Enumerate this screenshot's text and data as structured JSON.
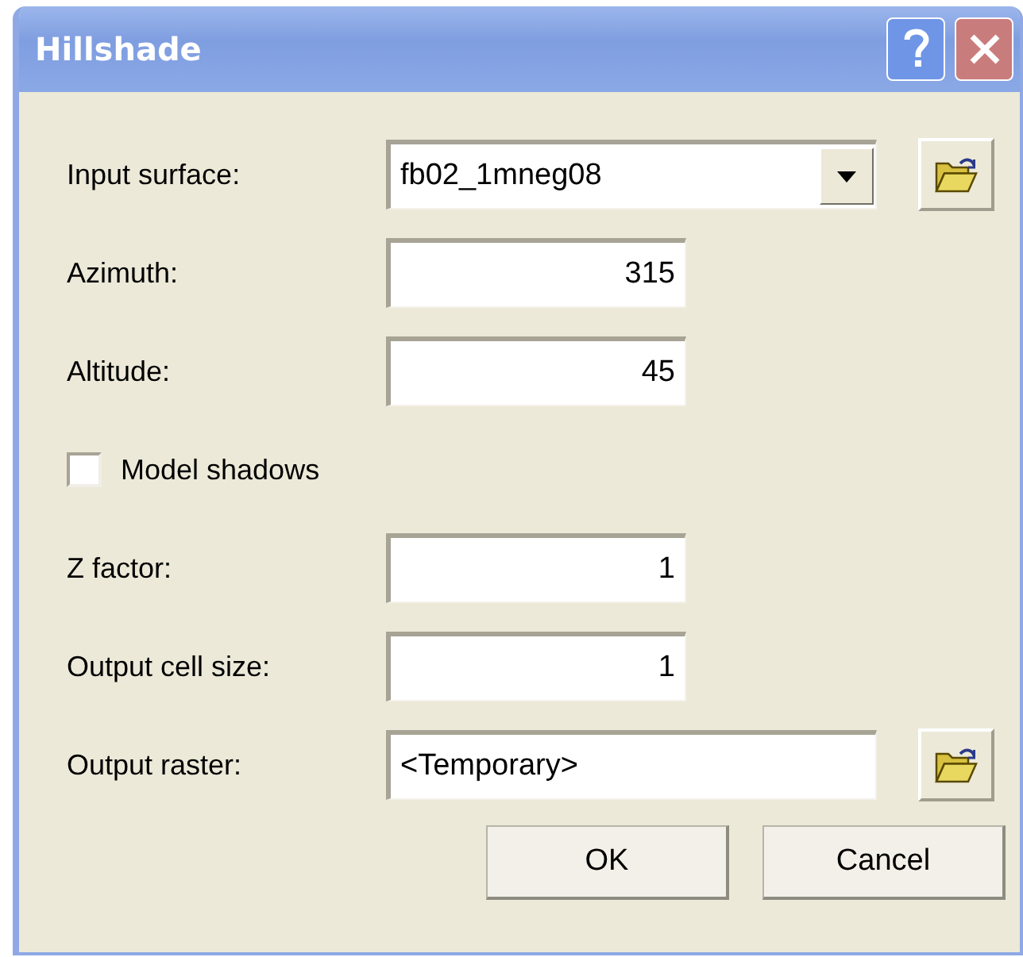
{
  "window": {
    "title": "Hillshade"
  },
  "fields": [
    {
      "kind": "combo",
      "label": "Input surface:",
      "value": "fb02_1mneg08",
      "browse": true
    },
    {
      "kind": "number",
      "label": "Azimuth:",
      "value": "315"
    },
    {
      "kind": "number",
      "label": "Altitude:",
      "value": "45"
    },
    {
      "kind": "checkbox",
      "label": "Model shadows",
      "checked": false
    },
    {
      "kind": "number",
      "label": "Z factor:",
      "value": "1"
    },
    {
      "kind": "number",
      "label": "Output cell size:",
      "value": "1"
    },
    {
      "kind": "text",
      "label": "Output raster:",
      "value": "<Temporary>",
      "browse": true
    }
  ],
  "buttons": [
    "OK",
    "Cancel"
  ]
}
